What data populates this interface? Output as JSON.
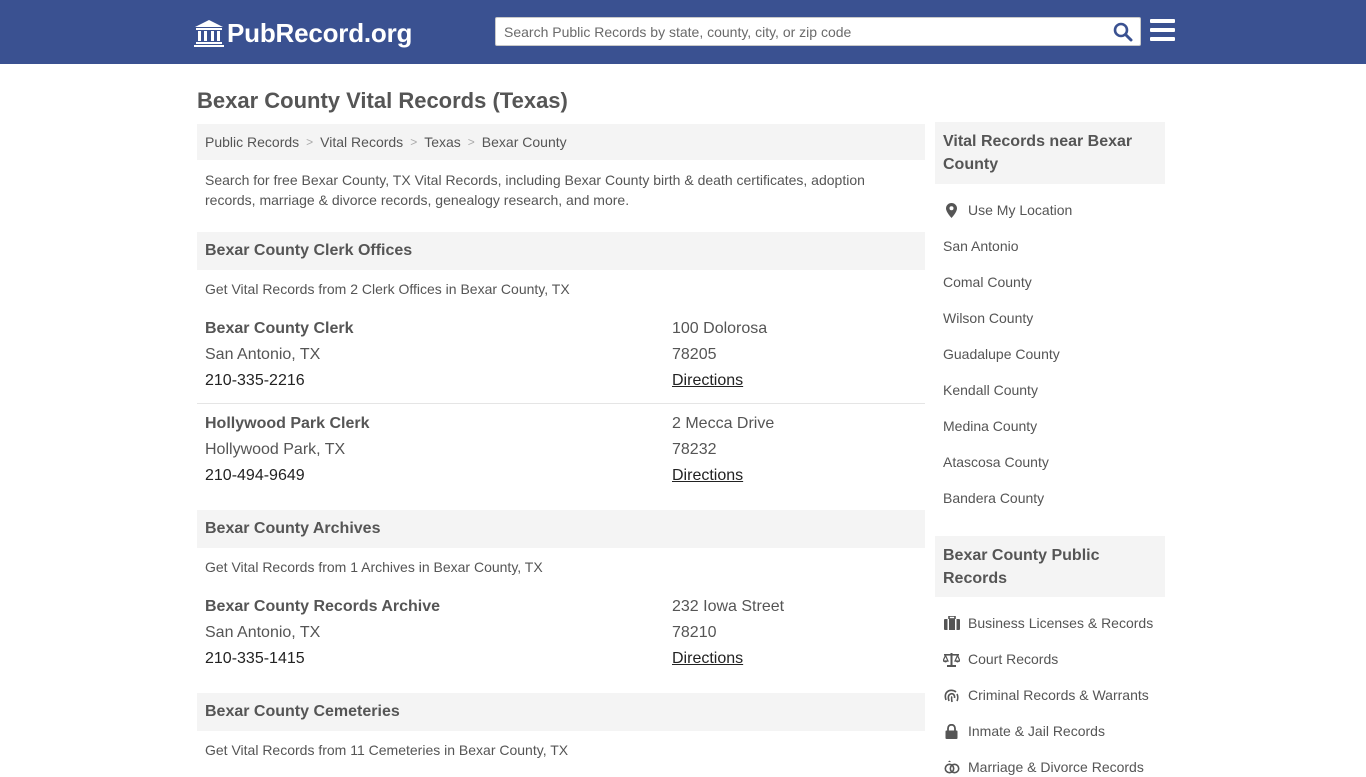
{
  "header": {
    "logo_text": "PubRecord.org",
    "search_placeholder": "Search Public Records by state, county, city, or zip code"
  },
  "page_title": "Bexar County Vital Records (Texas)",
  "breadcrumb": [
    "Public Records",
    "Vital Records",
    "Texas",
    "Bexar County"
  ],
  "intro": "Search for free Bexar County, TX Vital Records, including Bexar County birth & death certificates, adoption records, marriage & divorce records, genealogy research, and more.",
  "sections": {
    "clerk": {
      "title": "Bexar County Clerk Offices",
      "subtitle": "Get Vital Records from 2 Clerk Offices in Bexar County, TX",
      "entries": [
        {
          "name": "Bexar County Clerk",
          "city": "San Antonio, TX",
          "phone": "210-335-2216",
          "address": "100 Dolorosa",
          "zip": "78205",
          "directions": "Directions"
        },
        {
          "name": "Hollywood Park Clerk",
          "city": "Hollywood Park, TX",
          "phone": "210-494-9649",
          "address": "2 Mecca Drive",
          "zip": "78232",
          "directions": "Directions"
        }
      ]
    },
    "archives": {
      "title": "Bexar County Archives",
      "subtitle": "Get Vital Records from 1 Archives in Bexar County, TX",
      "entries": [
        {
          "name": "Bexar County Records Archive",
          "city": "San Antonio, TX",
          "phone": "210-335-1415",
          "address": "232 Iowa Street",
          "zip": "78210",
          "directions": "Directions"
        }
      ]
    },
    "cemeteries": {
      "title": "Bexar County Cemeteries",
      "subtitle": "Get Vital Records from 11 Cemeteries in Bexar County, TX"
    }
  },
  "sidebar": {
    "nearby": {
      "title": "Vital Records near Bexar County",
      "items": [
        "Use My Location",
        "San Antonio",
        "Comal County",
        "Wilson County",
        "Guadalupe County",
        "Kendall County",
        "Medina County",
        "Atascosa County",
        "Bandera County"
      ]
    },
    "public": {
      "title": "Bexar County Public Records",
      "items": [
        {
          "label": "Business Licenses & Records",
          "icon": "briefcase-icon"
        },
        {
          "label": "Court Records",
          "icon": "scales-icon"
        },
        {
          "label": "Criminal Records & Warrants",
          "icon": "fingerprint-icon"
        },
        {
          "label": "Inmate & Jail Records",
          "icon": "lock-icon"
        },
        {
          "label": "Marriage & Divorce Records",
          "icon": "rings-icon"
        }
      ]
    }
  },
  "colors": {
    "header_bg": "#3a5191",
    "panel_bg": "#f4f4f4",
    "text": "#555555",
    "search_icon": "#3a5191"
  }
}
